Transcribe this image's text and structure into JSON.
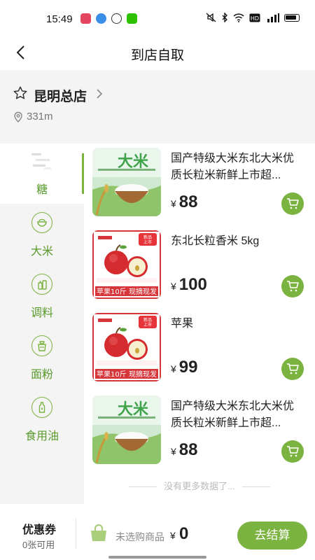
{
  "status_bar": {
    "time": "15:49",
    "icons": [
      "app-icon-red",
      "app-icon-blue",
      "chat-icon",
      "wechat-icon"
    ]
  },
  "header": {
    "title": "到店自取"
  },
  "store": {
    "name": "昆明总店",
    "distance": "331m"
  },
  "categories": [
    {
      "label": "糖",
      "active": true,
      "icon": "sugar-thumb"
    },
    {
      "label": "大米",
      "active": false,
      "icon": "rice-bowl-icon"
    },
    {
      "label": "调料",
      "active": false,
      "icon": "seasoning-icon"
    },
    {
      "label": "面粉",
      "active": false,
      "icon": "flour-icon"
    },
    {
      "label": "食用油",
      "active": false,
      "icon": "oil-bottle-icon"
    }
  ],
  "products": [
    {
      "name": "国产特级大米东北大米优质长粒米新鲜上市超...",
      "price_symbol": "¥",
      "price": "88",
      "image": "rice-product-image",
      "image_text": "大米"
    },
    {
      "name": "东北长粒香米 5kg",
      "price_symbol": "¥",
      "price": "100",
      "image": "apple-product-image",
      "image_text": "苹果10斤 现摘现发",
      "badge": "新品上市"
    },
    {
      "name": "苹果",
      "price_symbol": "¥",
      "price": "99",
      "image": "apple-product-image",
      "image_text": "苹果10斤 现摘现发",
      "badge": "新品上市"
    },
    {
      "name": "国产特级大米东北大米优质长粒米新鲜上市超...",
      "price_symbol": "¥",
      "price": "88",
      "image": "rice-product-image",
      "image_text": "大米"
    }
  ],
  "list_footer": "没有更多数据了...",
  "bottom_bar": {
    "coupon_title": "优惠券",
    "coupon_sub": "0张可用",
    "cart_info": "未选购商品",
    "total_symbol": "¥",
    "total": "0",
    "checkout_label": "去结算"
  },
  "colors": {
    "accent": "#7ab340",
    "category_text": "#5a9a2a"
  }
}
